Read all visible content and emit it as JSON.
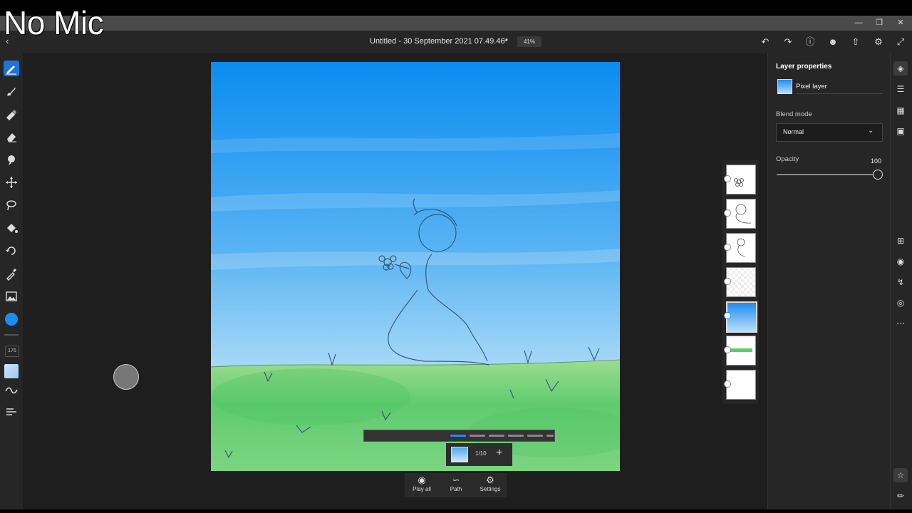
{
  "overlay": {
    "caption": "No Mic"
  },
  "window": {
    "minimize": "—",
    "restore": "❐",
    "close": "✕"
  },
  "header": {
    "back_icon": "chevron-left-icon",
    "document_title": "Untitled - 30 September 2021 07.49.46*",
    "zoom": "41%",
    "icons": [
      "undo-icon",
      "redo-icon",
      "help-icon",
      "account-icon",
      "share-icon",
      "settings-icon",
      "fullscreen-icon"
    ]
  },
  "tools": {
    "items": [
      "pencil-icon",
      "brush-icon",
      "fill-brush-icon",
      "eraser-icon",
      "smudge-icon",
      "move-icon",
      "lasso-icon",
      "paint-bucket-icon",
      "rotate-icon",
      "eyedropper-icon",
      "image-icon"
    ],
    "active": "pencil-icon",
    "brush_size": "175",
    "color": "#1d8ef0"
  },
  "timeline": {
    "frame_count": "1/10",
    "add_label": "+",
    "buttons": [
      {
        "label": "Play all",
        "icon": "play-all-icon"
      },
      {
        "label": "Path",
        "icon": "path-icon"
      },
      {
        "label": "Settings",
        "icon": "gear-icon"
      }
    ]
  },
  "layers": {
    "count": 7,
    "active_index": 4
  },
  "panel": {
    "title": "Layer properties",
    "layer_type": "Pixel layer",
    "blend_label": "Blend mode",
    "blend_value": "Normal",
    "opacity_label": "Opacity",
    "opacity_value": "100",
    "opacity_level": 1.0
  },
  "side_rail": {
    "icons": [
      "layers-icon",
      "adjustments-icon",
      "canvas-icon",
      "comments-icon",
      "add-layer-icon",
      "visibility-icon",
      "import-icon",
      "mask-icon",
      "more-icon",
      "shapes-icon",
      "ruler-icon"
    ]
  }
}
